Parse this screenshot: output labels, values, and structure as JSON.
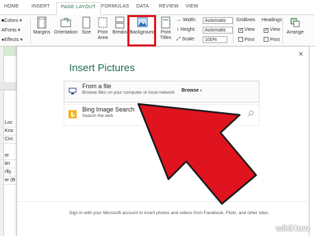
{
  "ribbon": {
    "tabs": [
      "HOME",
      "INSERT",
      "PAGE LAYOUT",
      "FORMULAS",
      "DATA",
      "REVIEW",
      "VIEW"
    ],
    "active_tab_index": 2,
    "themes": {
      "colors": "Colors",
      "fonts": "Fonts",
      "effects": "Effects"
    },
    "buttons": {
      "margins": "Margins",
      "orientation": "Orientation",
      "size": "Size",
      "print_area_1": "Print",
      "print_area_2": "Area",
      "breaks": "Breaks",
      "background": "Background",
      "print_titles_1": "Print",
      "print_titles_2": "Titles",
      "arrange": "Arrange"
    },
    "scale_to_fit": {
      "width_label": "Width:",
      "width_value": "Automatic",
      "height_label": "Height:",
      "height_value": "Automatic",
      "scale_label": "Scale:",
      "scale_value": "100%"
    },
    "sheet_options": {
      "gridlines": "Gridlines",
      "headings": "Headings",
      "view": "View",
      "print": "Print",
      "gridlines_view_checked": true,
      "gridlines_print_checked": false,
      "headings_view_checked": true,
      "headings_print_checked": false
    }
  },
  "sheet": {
    "cells": [
      "Loc",
      "Kno",
      "Circ",
      "er",
      "ler",
      "rfly",
      "er (B"
    ]
  },
  "dialog": {
    "title": "Insert Pictures",
    "close_icon": "close-icon",
    "options": [
      {
        "title": "From a file",
        "subtitle": "Browse files on your computer or local network",
        "action": "Browse ›",
        "icon": "computer-icon"
      },
      {
        "title": "Bing Image Search",
        "subtitle": "Search the web",
        "icon": "bing-icon"
      }
    ],
    "footer": "Sign in with your Microsoft account to insert photos and videos from Facebook, Flickr, and other sites."
  },
  "watermark": {
    "wiki": "wiki",
    "how": "How"
  },
  "colors": {
    "accent_green": "#217346",
    "dialog_title": "#1e6b52",
    "annotation_red": "#e0141e",
    "bing_yellow": "#f2b51d"
  }
}
